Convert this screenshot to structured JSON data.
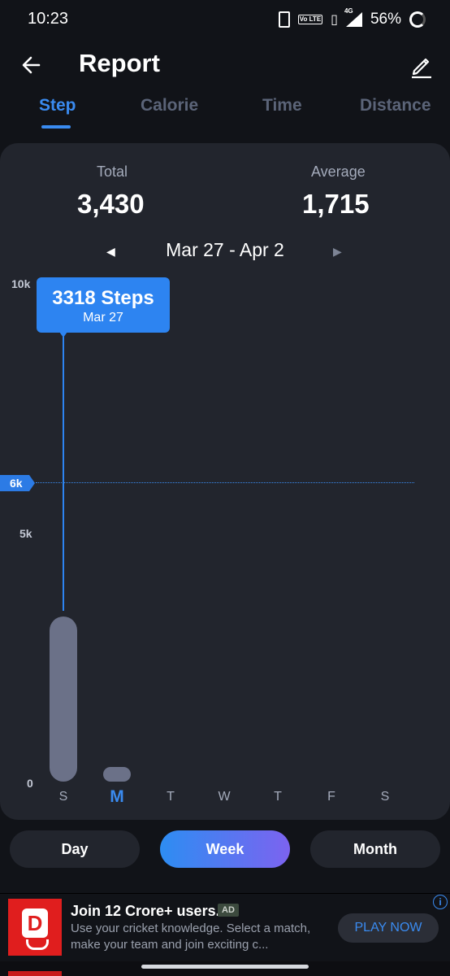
{
  "status_bar": {
    "time": "10:23",
    "volte": "Vo LTE",
    "network": "4G",
    "battery": "56%"
  },
  "header": {
    "title": "Report"
  },
  "tabs": [
    {
      "label": "Step",
      "active": true
    },
    {
      "label": "Calorie",
      "active": false
    },
    {
      "label": "Time",
      "active": false
    },
    {
      "label": "Distance",
      "active": false
    }
  ],
  "summary": {
    "total_label": "Total",
    "total_value": "3,430",
    "average_label": "Average",
    "average_value": "1,715"
  },
  "date_range": {
    "text": "Mar 27 - Apr 2",
    "prev_glyph": "◀",
    "next_glyph": "▶"
  },
  "chart": {
    "y_ticks": [
      "10k",
      "5k",
      "0"
    ],
    "goal_label": "6k",
    "tooltip": {
      "title": "3318 Steps",
      "date": "Mar 27"
    },
    "days": [
      "S",
      "M",
      "T",
      "W",
      "T",
      "F",
      "S"
    ],
    "selected_day": "M"
  },
  "chart_data": {
    "type": "bar",
    "categories": [
      "S",
      "M",
      "T",
      "W",
      "T",
      "F",
      "S"
    ],
    "values": [
      3318,
      112,
      0,
      0,
      0,
      0,
      0
    ],
    "ylim": [
      0,
      10000
    ],
    "goal": 6000
  },
  "period_buttons": {
    "day": "Day",
    "week": "Week",
    "month": "Month",
    "active": "Week"
  },
  "ad": {
    "title": "Join 12 Crore+ users.",
    "badge": "AD",
    "description": "Use your cricket knowledge. Select a match, make your team and join exciting c...",
    "cta": "PLAY NOW",
    "logo_letter": "D",
    "info_glyph": "i"
  },
  "colors": {
    "accent": "#3a8bf0",
    "background": "#111318",
    "card": "#22252d",
    "bar": "#6b7188"
  }
}
